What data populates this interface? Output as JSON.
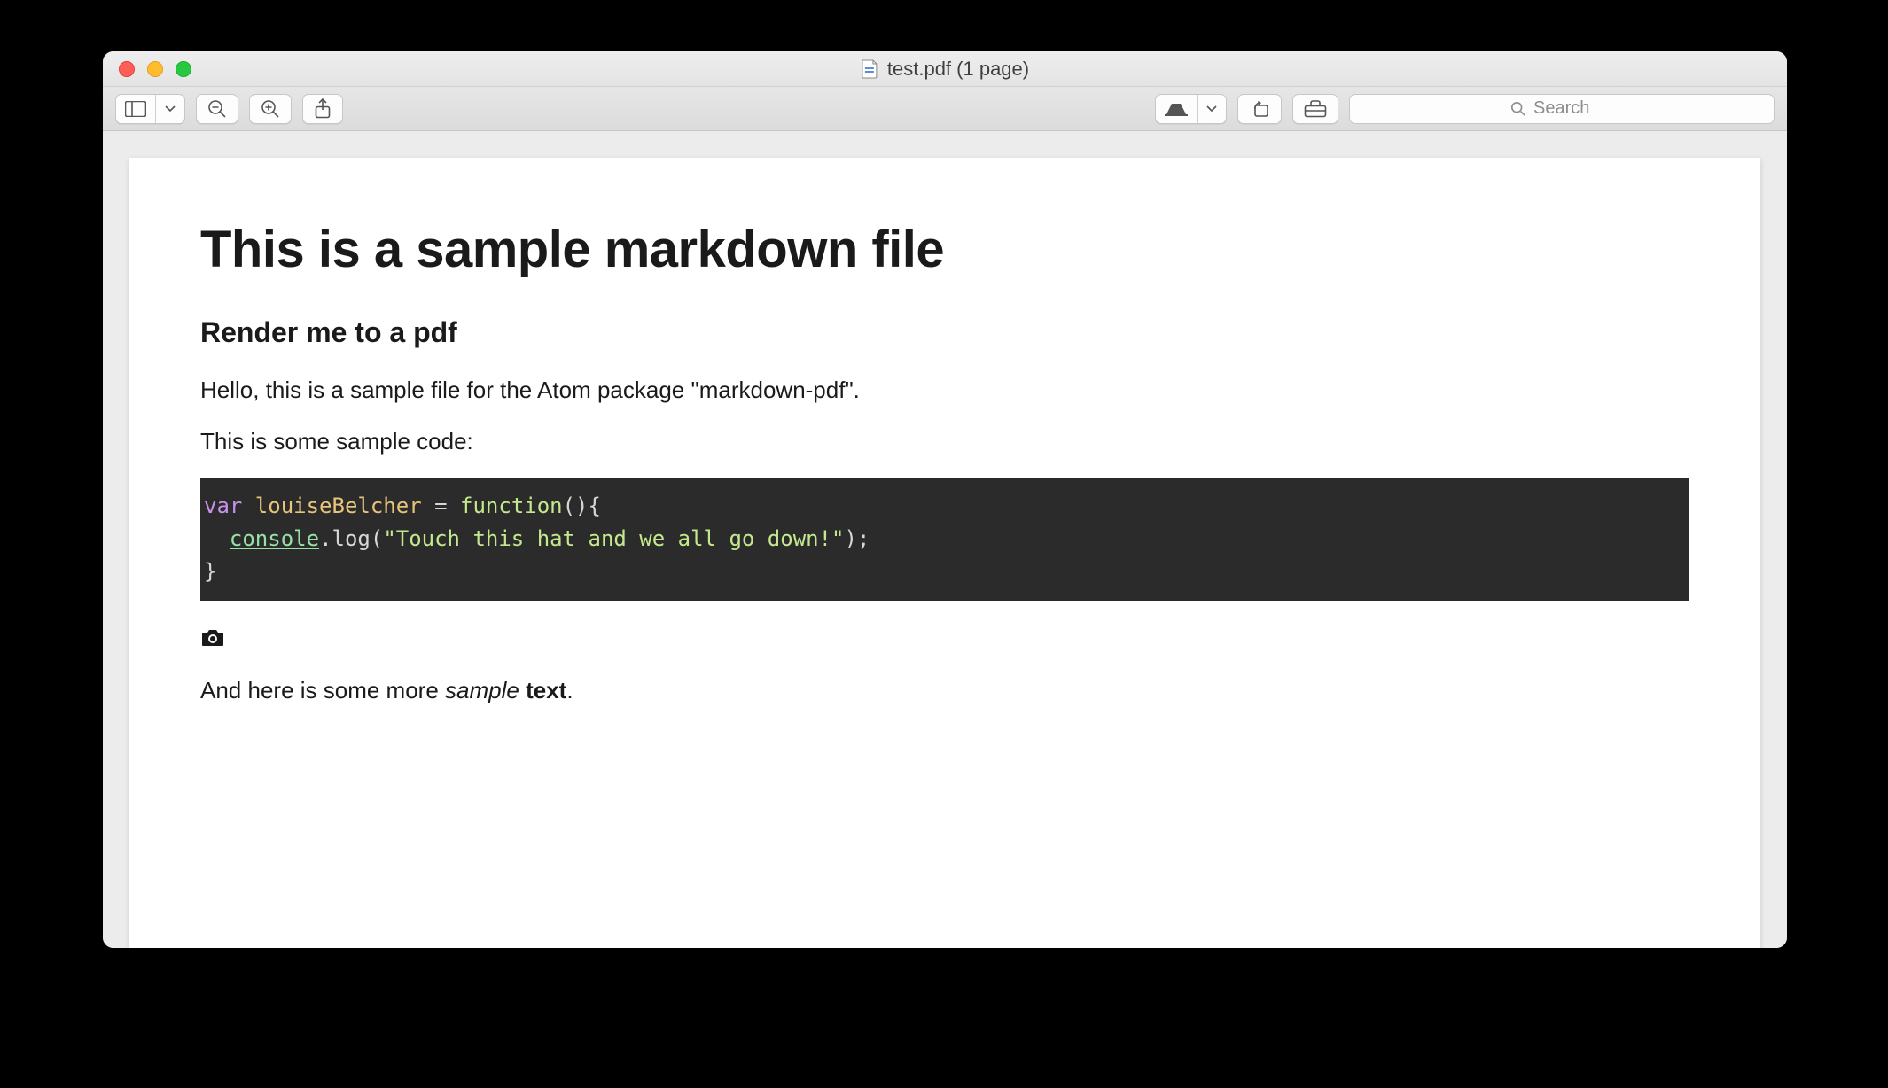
{
  "window": {
    "title": "test.pdf (1 page)"
  },
  "toolbar": {
    "icons": {
      "sidebar": "sidebar-icon",
      "zoom_out": "zoom-out-icon",
      "zoom_in": "zoom-in-icon",
      "share": "share-icon",
      "markup": "markup-pen-icon",
      "chevron": "chevron-down-icon",
      "rotate": "rotate-icon",
      "toolbox": "toolbox-icon"
    },
    "search_placeholder": "Search"
  },
  "document": {
    "h1": "This is a sample markdown file",
    "h2": "Render me to a pdf",
    "p1": "Hello, this is a sample file for the Atom package \"markdown-pdf\".",
    "p2": "This is some sample code:",
    "code": {
      "line1_kw": "var",
      "line1_ident": " louiseBelcher ",
      "line1_eq": "= ",
      "line1_func": "function",
      "line1_rest": "(){",
      "line2_indent": "  ",
      "line2_console": "console",
      "line2_dot_log": ".log(",
      "line2_string": "\"Touch this hat and we all go down!\"",
      "line2_end": ");",
      "line3": "}"
    },
    "image_placeholder_alt": "camera-icon",
    "p3_pre": "And here is some more ",
    "p3_italic": "sample",
    "p3_space": " ",
    "p3_bold": "text",
    "p3_period": "."
  }
}
